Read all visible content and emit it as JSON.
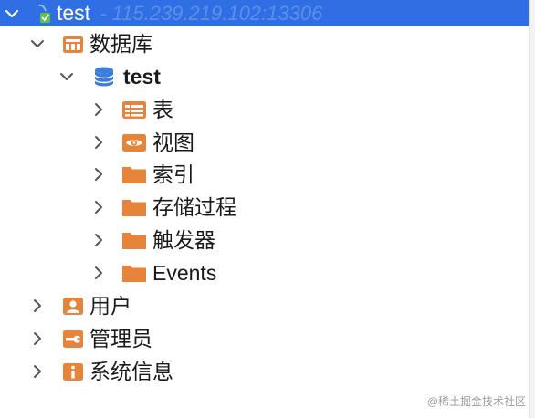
{
  "connection": {
    "name": "test",
    "address": "- 115.239.219.102:13306"
  },
  "tree": {
    "databases_label": "数据库",
    "database_name": "test",
    "children": {
      "tables": "表",
      "views": "视图",
      "indexes": "索引",
      "procedures": "存储过程",
      "triggers": "触发器",
      "events": "Events"
    },
    "users_label": "用户",
    "admins_label": "管理员",
    "sysinfo_label": "系统信息"
  },
  "watermark": "@稀土掘金技术社区",
  "colors": {
    "selection": "#2f6fe3",
    "folder": "#e8843a",
    "db_icon": "#3b7dd8",
    "chevron": "#555555"
  },
  "icons": {
    "connection": "mysql-dolphin-icon",
    "databases": "databases-folder-icon",
    "database": "database-cylinder-icon",
    "tables": "table-icon",
    "views": "eye-icon",
    "folder": "folder-icon",
    "users": "user-icon",
    "admins": "wrench-icon",
    "sysinfo": "info-icon"
  }
}
